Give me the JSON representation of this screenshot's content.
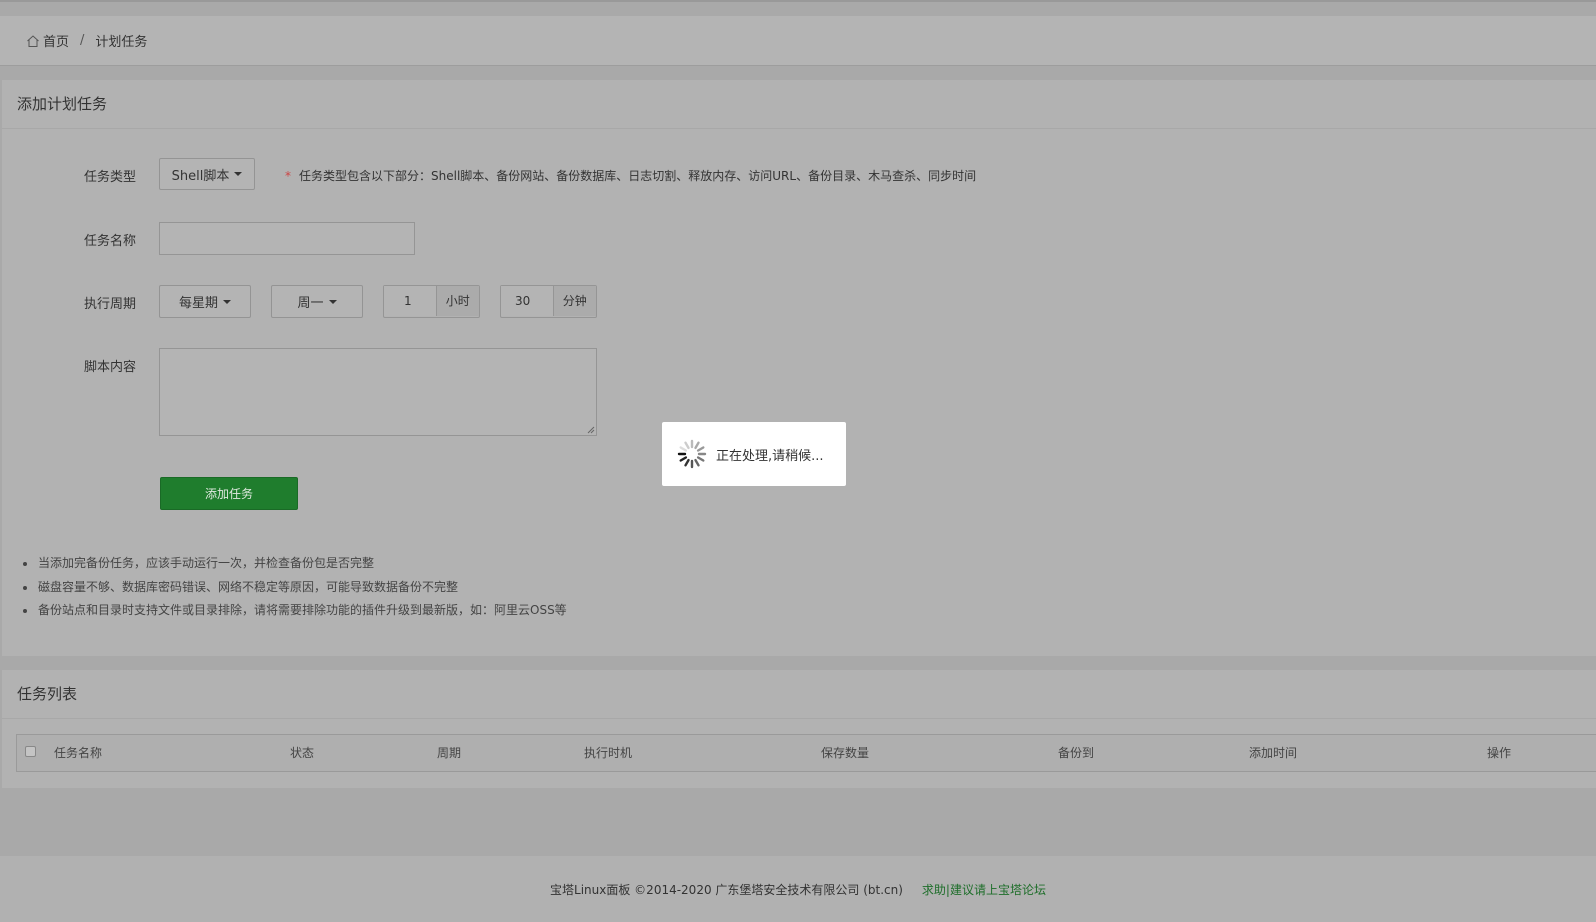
{
  "breadcrumb": {
    "home_label": "首页",
    "separator": "/",
    "current_label": "计划任务"
  },
  "add_panel": {
    "title": "添加计划任务",
    "task_type": {
      "label": "任务类型",
      "selected": "Shell脚本",
      "hint_star": "*",
      "hint": "任务类型包含以下部分：Shell脚本、备份网站、备份数据库、日志切割、释放内存、访问URL、备份目录、木马查杀、同步时间"
    },
    "task_name": {
      "label": "任务名称",
      "value": ""
    },
    "period": {
      "label": "执行周期",
      "cycle": "每星期",
      "weekday": "周一",
      "hour_value": "1",
      "hour_unit": "小时",
      "minute_value": "30",
      "minute_unit": "分钟"
    },
    "script": {
      "label": "脚本内容",
      "value": ""
    },
    "submit_label": "添加任务",
    "notes": [
      "当添加完备份任务，应该手动运行一次，并检查备份包是否完整",
      "磁盘容量不够、数据库密码错误、网络不稳定等原因，可能导致数据备份不完整",
      "备份站点和目录时支持文件或目录排除，请将需要排除功能的插件升级到最新版，如：阿里云OSS等"
    ]
  },
  "list_panel": {
    "title": "任务列表",
    "columns": [
      "任务名称",
      "状态",
      "周期",
      "执行时机",
      "保存数量",
      "备份到",
      "添加时间",
      "操作"
    ]
  },
  "footer": {
    "copyright": "宝塔Linux面板 ©2014-2020 广东堡塔安全技术有限公司 (bt.cn)",
    "link": "求助|建议请上宝塔论坛"
  },
  "loading": {
    "text": "正在处理,请稍候..."
  },
  "colors": {
    "accent_green": "#1f7d2d",
    "link_green": "#1e6e2a",
    "required_star": "#c44444"
  }
}
